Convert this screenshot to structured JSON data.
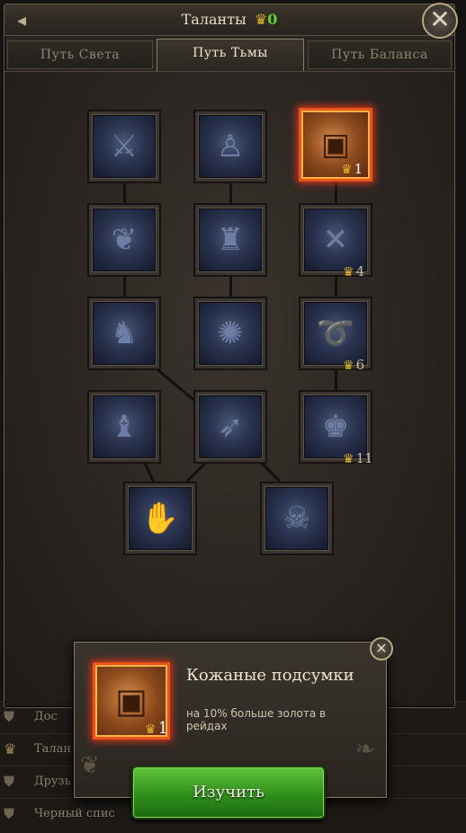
{
  "header": {
    "title": "Таланты",
    "points": "0",
    "back_icon": "back-arrow-icon",
    "close_icon": "close-icon"
  },
  "tabs": [
    {
      "label": "Путь Света",
      "active": false
    },
    {
      "label": "Путь Тьмы",
      "active": true
    },
    {
      "label": "Путь Баланса",
      "active": false
    }
  ],
  "talents": [
    {
      "icon": "dagger-icon",
      "cost": "",
      "active": false
    },
    {
      "icon": "strongman-icon",
      "cost": "",
      "active": false
    },
    {
      "icon": "leather-pouch-icon",
      "cost": "1",
      "active": true
    },
    {
      "icon": "flame-spirit-icon",
      "cost": "",
      "active": false
    },
    {
      "icon": "warrior-glow-icon",
      "cost": "",
      "active": false
    },
    {
      "icon": "crossed-axes-icon",
      "cost": "4",
      "active": false
    },
    {
      "icon": "beast-icon",
      "cost": "",
      "active": false
    },
    {
      "icon": "dark-sigil-icon",
      "cost": "",
      "active": false
    },
    {
      "icon": "rope-icon",
      "cost": "6",
      "active": false
    },
    {
      "icon": "hooded-figure-icon",
      "cost": "",
      "active": false
    },
    {
      "icon": "crossbow-icon",
      "cost": "",
      "active": false
    },
    {
      "icon": "muscle-man-icon",
      "cost": "11",
      "active": false
    },
    {
      "icon": "open-hand-icon",
      "cost": "",
      "active": false
    },
    {
      "icon": "skull-icon",
      "cost": "",
      "active": false
    }
  ],
  "popup": {
    "title": "Кожаные подсумки",
    "description": "на 10% больше золота в рейдах",
    "cost": "1",
    "icon": "leather-pouch-icon",
    "button_label": "Изучить"
  },
  "background_menu": [
    {
      "label": "Дос",
      "icon": "shield-icon"
    },
    {
      "label": "Талан",
      "icon": "crown-icon"
    },
    {
      "label": "Друзь",
      "icon": "shield-icon"
    },
    {
      "label": "Черный спис",
      "icon": "shield-icon"
    }
  ],
  "colors": {
    "accent_gold": "#e5b82a",
    "points_green": "#5fd42c",
    "selected_orange": "#e8541c",
    "button_green": "#2f8f1c"
  }
}
